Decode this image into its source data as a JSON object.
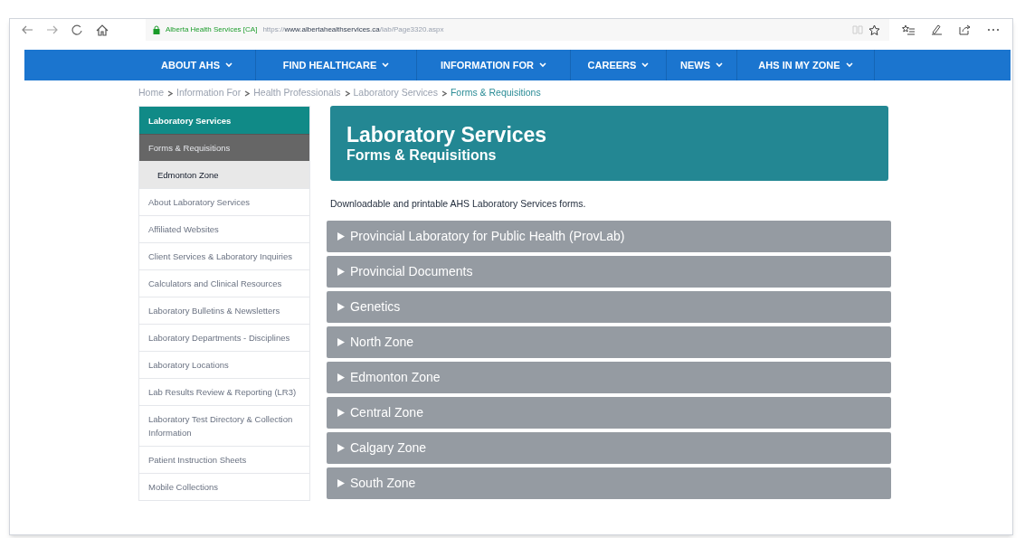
{
  "browser": {
    "site_name": "Alberta Health Services [CA]",
    "url_prefix": "https://",
    "url_host": "www.albertahealthservices.ca",
    "url_path": "/lab/Page3320.aspx"
  },
  "nav": [
    {
      "label": "ABOUT AHS"
    },
    {
      "label": "FIND HEALTHCARE"
    },
    {
      "label": "INFORMATION FOR"
    },
    {
      "label": "CAREERS"
    },
    {
      "label": "NEWS"
    },
    {
      "label": "AHS IN MY ZONE"
    }
  ],
  "breadcrumb": [
    {
      "label": "Home",
      "selected": false
    },
    {
      "label": "Information For",
      "selected": false
    },
    {
      "label": "Health Professionals",
      "selected": false
    },
    {
      "label": "Laboratory Services",
      "selected": false
    },
    {
      "label": "Forms & Requisitions",
      "selected": true
    }
  ],
  "sidebar": [
    {
      "label": "Laboratory Services",
      "kind": "section"
    },
    {
      "label": "Forms & Requisitions",
      "kind": "current"
    },
    {
      "label": "Edmonton Zone",
      "kind": "sub"
    },
    {
      "label": "About Laboratory Services",
      "kind": "link"
    },
    {
      "label": "Affiliated Websites",
      "kind": "link"
    },
    {
      "label": "Client Services & Laboratory Inquiries",
      "kind": "link"
    },
    {
      "label": "Calculators and Clinical Resources",
      "kind": "link"
    },
    {
      "label": "Laboratory Bulletins & Newsletters",
      "kind": "link"
    },
    {
      "label": "Laboratory Departments - Disciplines",
      "kind": "link"
    },
    {
      "label": "Laboratory Locations",
      "kind": "link"
    },
    {
      "label": "Lab Results Review & Reporting (LR3)",
      "kind": "link"
    },
    {
      "label": "Laboratory Test Directory & Collection Information",
      "kind": "link"
    },
    {
      "label": "Patient Instruction Sheets",
      "kind": "link"
    },
    {
      "label": "Mobile Collections",
      "kind": "link"
    }
  ],
  "banner": {
    "title": "Laboratory Services",
    "subtitle": "Forms & Requisitions"
  },
  "intro": "Downloadable and printable AHS Laboratory Services forms.",
  "sections": [
    {
      "label": "Provincial Laboratory for Public Health (ProvLab)",
      "expanded": false
    },
    {
      "label": "Provincial Documents",
      "expanded": false
    },
    {
      "label": "Genetics",
      "expanded": false
    },
    {
      "label": "North Zone",
      "expanded": false
    },
    {
      "label": "Edmonton Zone",
      "expanded": false
    },
    {
      "label": "Central Zone",
      "expanded": false
    },
    {
      "label": "Calgary Zone",
      "expanded": false
    },
    {
      "label": "South Zone",
      "expanded": false
    }
  ]
}
